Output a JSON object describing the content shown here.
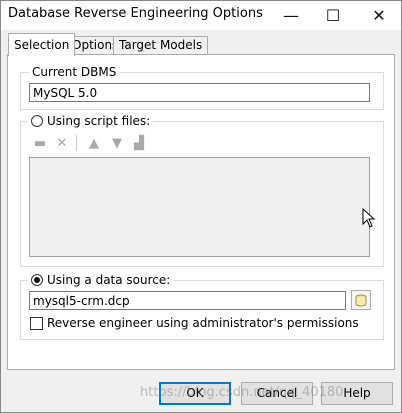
{
  "window": {
    "title": "Database Reverse Engineering Options",
    "controls": {
      "minimize": "—",
      "maximize": "☐",
      "close": "✕"
    }
  },
  "tabs": [
    {
      "label": "Selection",
      "active": true
    },
    {
      "label": "Options",
      "active": false
    },
    {
      "label": "Target Models",
      "active": false
    }
  ],
  "current_dbms": {
    "legend": "Current DBMS",
    "value": "MySQL 5.0"
  },
  "script_files": {
    "label": "Using script files:",
    "selected": false,
    "toolbar_icons": [
      "add-file-icon",
      "delete-icon",
      "move-up-icon",
      "move-down-icon",
      "browse-icon"
    ]
  },
  "data_source": {
    "label": "Using a data source:",
    "selected": true,
    "value": "mysql5-crm.dcp",
    "admin_checkbox_label": "Reverse engineer using administrator's permissions",
    "admin_checked": false
  },
  "buttons": {
    "ok": "OK",
    "cancel": "Cancel",
    "help": "Help"
  },
  "watermark": "https://blog.csdn.net/qq_40180"
}
